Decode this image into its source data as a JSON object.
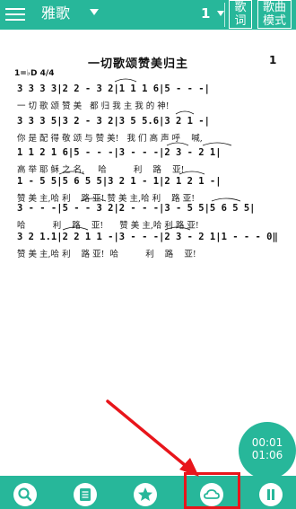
{
  "topbar": {
    "category": "雅歌",
    "key_number": "1",
    "lyrics_button": "歌\n词",
    "mode_button": "歌曲\n模式"
  },
  "score": {
    "title": "一切歌颂赞美归主",
    "page_number": "1",
    "key_signature": "1=♭D 4/4",
    "lines": [
      {
        "notes": "3 3 3 3|2 2 - 3 2|1 1 1 6|5 - - -|",
        "lyrics": "一 切 歌 颂 赞 美   都 归 我 主 我 的 神!"
      },
      {
        "notes": "3 3 3 5|3 2 - 3 2|3 5 5.6|3 2 1 -|",
        "lyrics": "你 是 配 得 敬 颂 与 赞 美!   我 们 高 声 呼    喊,"
      },
      {
        "notes": "1 1 2 1 6|5 - - -|3 - - -|2 3 - 2 1|",
        "lyrics": "高 举 耶 稣 之 名,     哈          利    路    亚!"
      },
      {
        "notes": "1 - 5 5|5 6 5 5|3 2 1 - 1|2 1 2 1 -|",
        "lyrics": "赞 美 主,哈 利    路 亚! 赞 美 主,哈 利    路 亚!"
      },
      {
        "notes": "3 - - -|5 - - 3 2|2 - - -|3 - 5 5|5 6 5 5|",
        "lyrics": "哈          利    路    亚!      赞 美 主,哈 利 路 亚!"
      },
      {
        "notes": "3 2 1.1|2 2 1 1 -|3 - - -|2 3 - 2 1|1 - - - 0‖",
        "lyrics": "赞 美 主,哈 利    路 亚!  哈          利    路    亚!"
      }
    ]
  },
  "timer": {
    "elapsed": "00:01",
    "total": "01:06"
  },
  "bottombar": {
    "buttons": [
      {
        "icon": "search-icon"
      },
      {
        "icon": "songbook-icon"
      },
      {
        "icon": "star-icon"
      },
      {
        "icon": "cloud-icon"
      },
      {
        "icon": "pause-icon"
      }
    ]
  },
  "colors": {
    "accent": "#27b79a",
    "annotation": "#e8151b"
  }
}
